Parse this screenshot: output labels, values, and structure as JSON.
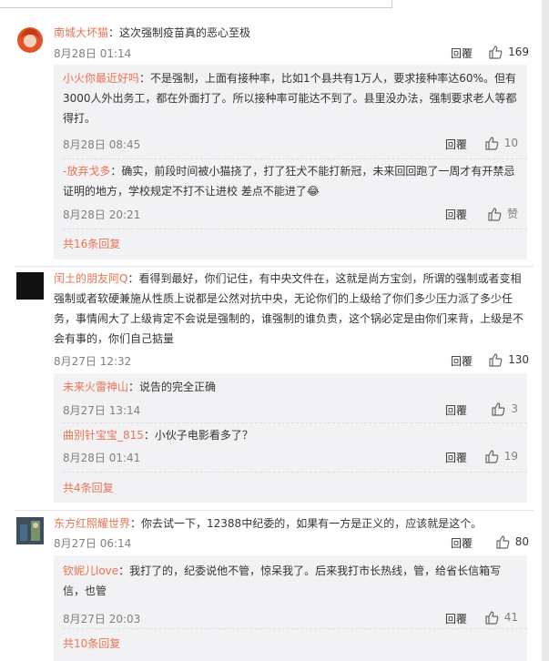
{
  "comments": [
    {
      "user": "南城大坏猫",
      "text": "：这次强制疫苗真的恶心至极",
      "time": "8月28日 01:14",
      "reply": "回覆",
      "likes": "169",
      "replies": [
        {
          "user": "小火你最近好吗",
          "text": "：不是强制，上面有接种率，比如1个县共有1万人，要求接种率达60%。但有3000人外出务工，都在外面打了。所以接种率可能达不到了。县里没办法，强制要求老人等都得打。",
          "time": "8月28日 08:45",
          "reply": "回覆",
          "likes": "10"
        },
        {
          "user": "-放弃戈多",
          "text": "：确实，前段时间被小猫挠了，打了狂犬不能打新冠，未来回回跑了一周才有开禁忌证明的地方，学校规定不打不让进校 差点不能进了😂",
          "time": "8月28日 20:21",
          "reply": "回覆",
          "likes": "赞"
        }
      ],
      "more": "共16条回复"
    },
    {
      "user": "闰土的朋友阿Q",
      "text": "：看得到最好，你们记住，有中央文件在，这就是尚方宝剑，所谓的强制或者变相强制或者软硬兼施从性质上说都是公然对抗中央，无论你们的上级给了你们多少压力派了多少任务，事情闹大了上级肯定不会说是强制的，谁强制的谁负责，这个锅必定是由你们来背，上级是不会有事的，你们自己掂量",
      "time": "8月27日 12:32",
      "reply": "回覆",
      "likes": "130",
      "replies": [
        {
          "user": "未来火雷神山",
          "text": "：说告的完全正确",
          "time": "8月27日 13:14",
          "reply": "回覆",
          "likes": "3"
        },
        {
          "user": "曲别针宝宝_815",
          "text": "：小伙子电影看多了？",
          "time": "8月28日 01:41",
          "reply": "回覆",
          "likes": "19"
        }
      ],
      "more": "共4条回复"
    },
    {
      "user": "东方红照耀世界",
      "text": "：你去试一下，12388中纪委的，如果有一方是正义的，应该就是这个。",
      "time": "8月27日 06:14",
      "reply": "回覆",
      "likes": "80",
      "replies": [
        {
          "user": "钦妮儿love",
          "text": "：我打了的，纪委说他不管，惊呆我了。后来我打市长热线，管，给省长信箱写信，也管",
          "time": "8月27日 20:03",
          "reply": "回覆",
          "likes": "41"
        }
      ],
      "more": "共10条回复"
    }
  ]
}
